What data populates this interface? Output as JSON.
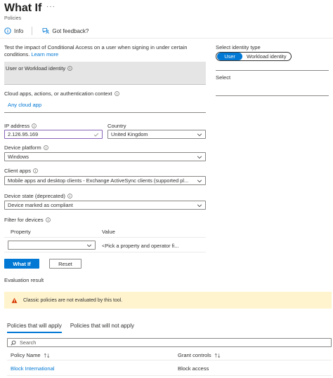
{
  "header": {
    "title": "What If",
    "more": "···",
    "subtitle": "Policies"
  },
  "toolbar": {
    "info_label": "Info",
    "feedback_label": "Got feedback?"
  },
  "description": {
    "text": "Test the impact of Conditional Access on a user when signing in under certain conditions. ",
    "learn_more": "Learn more"
  },
  "identity": {
    "section_label": "User or Workload identity",
    "type_label": "Select identity type",
    "option_user": "User",
    "option_workload": "Workload identity",
    "select_label": "Select"
  },
  "cloud_apps": {
    "label": "Cloud apps, actions, or authentication context",
    "value": "Any cloud app"
  },
  "ip": {
    "label": "IP address",
    "value": "2.126.95.169"
  },
  "country": {
    "label": "Country",
    "value": "United Kingdom"
  },
  "device_platform": {
    "label": "Device platform",
    "value": "Windows"
  },
  "client_apps": {
    "label": "Client apps",
    "value": "Mobile apps and desktop clients - Exchange ActiveSync clients (supported pl..."
  },
  "device_state": {
    "label": "Device state (deprecated)",
    "value": "Device marked as compliant"
  },
  "filter": {
    "label": "Filter for devices",
    "property_header": "Property",
    "value_header": "Value",
    "value_placeholder": "<Pick a property and operator fi..."
  },
  "actions": {
    "whatif_label": "What If",
    "reset_label": "Reset"
  },
  "evaluation": {
    "label": "Evaluation result",
    "warning": "Classic policies are not evaluated by this tool."
  },
  "results": {
    "tabs": [
      "Policies that will apply",
      "Policies that will not apply"
    ],
    "search_placeholder": "Search",
    "columns": {
      "policy_name": "Policy Name",
      "grant_controls": "Grant controls"
    },
    "rows": [
      {
        "policy_name": "Block International",
        "grant_controls": "Block access"
      }
    ]
  },
  "colors": {
    "accent": "#0078d4",
    "warning_bg": "#fff4ce",
    "warning_icon": "#d83b01"
  }
}
